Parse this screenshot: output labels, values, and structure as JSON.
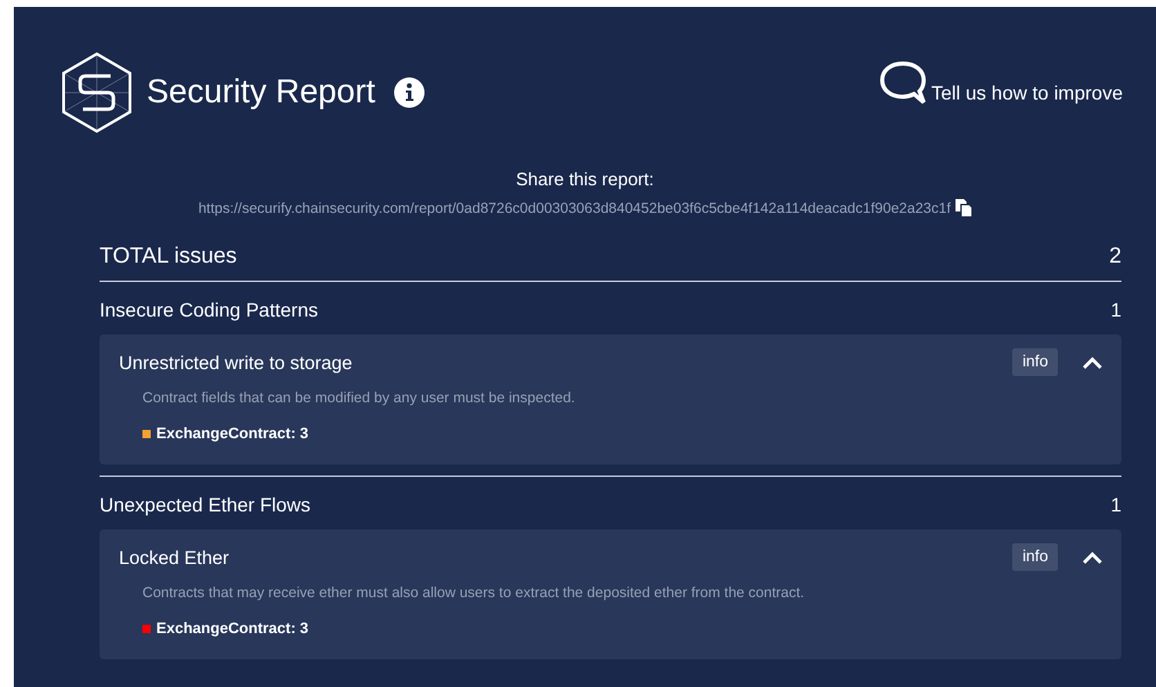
{
  "header": {
    "title": "Security Report",
    "feedback": "Tell us how to improve"
  },
  "share": {
    "heading": "Share this report:",
    "url": "https://securify.chainsecurity.com/report/0ad8726c0d00303063d840452be03f6c5cbe4f142a114deacadc1f90e2a23c1f"
  },
  "total": {
    "label": "TOTAL issues",
    "count": "2"
  },
  "categories": [
    {
      "name": "Insecure Coding Patterns",
      "count": "1",
      "issues": [
        {
          "title": "Unrestricted write to storage",
          "info": "info",
          "expanded": true,
          "description": "Contract fields that can be modified by any user must be inspected.",
          "findings": [
            {
              "label": "ExchangeContract: 3",
              "color": "#f5a031"
            }
          ]
        }
      ]
    },
    {
      "name": "Unexpected Ether Flows",
      "count": "1",
      "issues": [
        {
          "title": "Locked Ether",
          "info": "info",
          "expanded": true,
          "description": "Contracts that may receive ether must also allow users to extract the deposited ether from the contract.",
          "findings": [
            {
              "label": "ExchangeContract: 3",
              "color": "#ff0000"
            }
          ]
        }
      ]
    }
  ]
}
